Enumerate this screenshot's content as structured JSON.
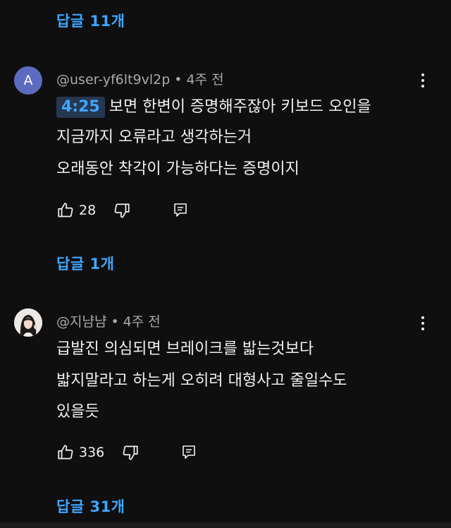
{
  "replies_top": {
    "label": "답글 11개"
  },
  "comments": [
    {
      "avatar_letter": "A",
      "handle": "@user-yf6lt9vl2p",
      "time": "4주 전",
      "timestamp_link": "4:25",
      "lines": [
        "보면 한변이 증명해주잖아 키보드 오인을",
        "지금까지 오류라고 생각하는거",
        "오래동안 착각이 가능하다는 증명이지"
      ],
      "likes": "28",
      "replies_label": "답글 1개"
    },
    {
      "handle": "@지냠냠",
      "time": "4주 전",
      "lines": [
        "급발진 의심되면 브레이크를 밟는것보다",
        "밟지말라고 하는게 오히려 대형사고 줄일수도",
        "있을듯"
      ],
      "likes": "336",
      "replies_label": "답글 31개"
    }
  ],
  "meta_separator": "•",
  "colors": {
    "background": "#0f0f0f",
    "link": "#3ea6ff",
    "secondary_text": "#aaaaaa",
    "avatar_a": "#5c6bc0"
  },
  "icons": [
    "like-icon",
    "dislike-icon",
    "reply-icon",
    "more-vert-icon"
  ]
}
